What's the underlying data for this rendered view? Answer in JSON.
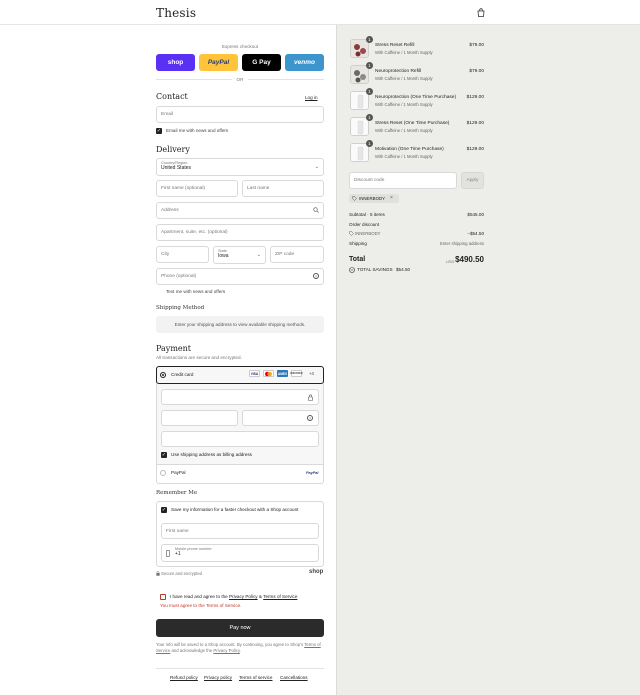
{
  "brand": "Thesis",
  "express": {
    "label": "Express checkout",
    "or": "OR",
    "shop": "shop",
    "paypal": "PayPal",
    "gpay": "G Pay",
    "venmo": "venmo"
  },
  "contact": {
    "heading": "Contact",
    "login": "Log in",
    "email_placeholder": "Email",
    "news_label": "Email me with news and offers"
  },
  "delivery": {
    "heading": "Delivery",
    "country_label": "Country/Region",
    "country_value": "United States",
    "first_name": "First name (optional)",
    "last_name": "Last name",
    "address": "Address",
    "apartment": "Apartment, suite, etc. (optional)",
    "city": "City",
    "state_label": "State",
    "state_value": "Iowa",
    "zip": "ZIP code",
    "phone": "Phone (optional)",
    "text_label": "Text me with news and offers"
  },
  "shipping": {
    "heading": "Shipping Method",
    "notice": "Enter your shipping address to view available shipping methods."
  },
  "payment": {
    "heading": "Payment",
    "subtitle": "All transactions are secure and encrypted.",
    "credit_card": "Credit card",
    "cards": [
      "VISA",
      "MC",
      "AMEX",
      "DISCOVER"
    ],
    "more": "+4",
    "billing_label": "Use shipping address as billing address",
    "paypal": "PayPal",
    "paypal_logo": "PayPal"
  },
  "remember": {
    "heading": "Remember Me",
    "save_label": "Save my information for a faster checkout with a Shop account",
    "first_name": "First name",
    "mobile_label": "Mobile phone number",
    "mobile_value": "+1",
    "secure": "Secure and encrypted",
    "shop": "shop"
  },
  "terms": {
    "agree_pre": "I have read and agree to the",
    "privacy": "Privacy Policy",
    "amp": "&",
    "tos": "Terms of Service",
    "error": "You must agree to the Terms of Service."
  },
  "pay_now": "Pay now",
  "disclaimer": {
    "line1": "Your info will be saved to a Shop account. By continuing, you agree to Shop's",
    "tos": "Terms of Service",
    "mid": "and acknowledge the",
    "privacy": "Privacy Policy",
    "end": "."
  },
  "footer": [
    "Refund policy",
    "Privacy policy",
    "Terms of service",
    "Cancellations"
  ],
  "cart": {
    "items": [
      {
        "name": "Stress Reset Refill",
        "sub": "With Caffeine / 1 Month Supply",
        "price": "$79.00",
        "qty": "1"
      },
      {
        "name": "Neuroprotection Refill",
        "sub": "With Caffeine / 1 Month Supply",
        "price": "$79.00",
        "qty": "1"
      },
      {
        "name": "Neuroprotection (One Time Purchase)",
        "sub": "With Caffeine / 1 Month Supply",
        "price": "$129.00",
        "qty": "1"
      },
      {
        "name": "Stress Reset (One Time Purchase)",
        "sub": "With Caffeine / 1 Month Supply",
        "price": "$129.00",
        "qty": "1"
      },
      {
        "name": "Motivation (One Time Purchase)",
        "sub": "With Caffeine / 1 Month Supply",
        "price": "$129.00",
        "qty": "1"
      }
    ],
    "discount_placeholder": "Discount code",
    "apply": "Apply",
    "code_tag": "INNERBODY",
    "subtotal_label": "Subtotal · 5 items",
    "subtotal_value": "$545.00",
    "order_discount": "Order discount",
    "discount_code": "INNERBODY",
    "discount_value": "−$54.50",
    "shipping_label": "Shipping",
    "shipping_value": "Enter shipping address",
    "total_label": "Total",
    "currency": "USD",
    "total_value": "$490.50",
    "savings_label": "TOTAL SAVINGS",
    "savings_value": "$54.50"
  },
  "colors": {
    "shop": "#5a31f4",
    "paypal": "#ffc439",
    "gpay": "#000000",
    "venmo": "#3d95ce",
    "error": "#c0392b",
    "pay_button": "#2b2b2b",
    "sidebar": "#ededea"
  }
}
